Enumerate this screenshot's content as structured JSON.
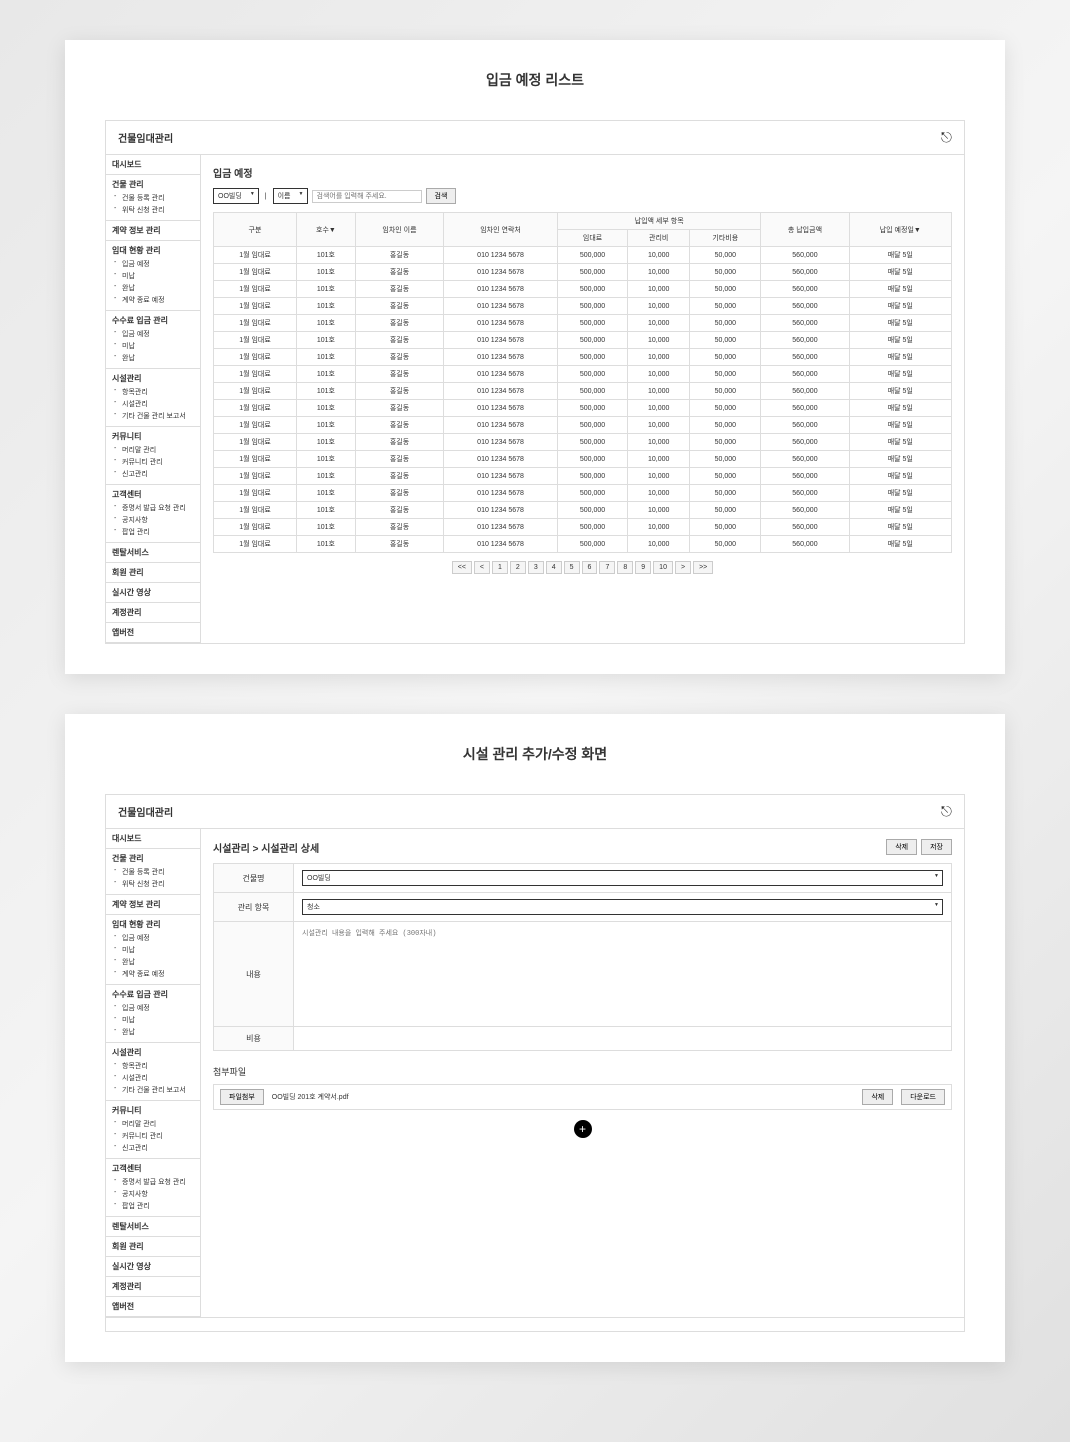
{
  "screen1": {
    "title": "입금 예정 리스트",
    "app_title": "건물임대관리",
    "page_heading": "입금 예정",
    "search": {
      "building_select": "OO빌딩",
      "type_select": "이름",
      "placeholder": "검색어를 입력해 주세요.",
      "button": "검색"
    },
    "table": {
      "headers": {
        "division": "구분",
        "room": "호수▼",
        "tenant_name": "임차인 이름",
        "tenant_contact": "임차인 연락처",
        "payment_detail": "납입액 세부 항목",
        "rent": "임대료",
        "mgmt_fee": "관리비",
        "other_fee": "기타비용",
        "total": "총 납입금액",
        "due_date": "납입 예정일▼"
      },
      "rows": [
        {
          "division": "1월 임대료",
          "room": "101호",
          "name": "홍길동",
          "contact": "010 1234 5678",
          "rent": "500,000",
          "mgmt": "10,000",
          "other": "50,000",
          "total": "560,000",
          "due": "매달 5일"
        },
        {
          "division": "1월 임대료",
          "room": "101호",
          "name": "홍길동",
          "contact": "010 1234 5678",
          "rent": "500,000",
          "mgmt": "10,000",
          "other": "50,000",
          "total": "560,000",
          "due": "매달 5일"
        },
        {
          "division": "1월 임대료",
          "room": "101호",
          "name": "홍길동",
          "contact": "010 1234 5678",
          "rent": "500,000",
          "mgmt": "10,000",
          "other": "50,000",
          "total": "560,000",
          "due": "매달 5일"
        },
        {
          "division": "1월 임대료",
          "room": "101호",
          "name": "홍길동",
          "contact": "010 1234 5678",
          "rent": "500,000",
          "mgmt": "10,000",
          "other": "50,000",
          "total": "560,000",
          "due": "매달 5일"
        },
        {
          "division": "1월 임대료",
          "room": "101호",
          "name": "홍길동",
          "contact": "010 1234 5678",
          "rent": "500,000",
          "mgmt": "10,000",
          "other": "50,000",
          "total": "560,000",
          "due": "매달 5일"
        },
        {
          "division": "1월 임대료",
          "room": "101호",
          "name": "홍길동",
          "contact": "010 1234 5678",
          "rent": "500,000",
          "mgmt": "10,000",
          "other": "50,000",
          "total": "560,000",
          "due": "매달 5일"
        },
        {
          "division": "1월 임대료",
          "room": "101호",
          "name": "홍길동",
          "contact": "010 1234 5678",
          "rent": "500,000",
          "mgmt": "10,000",
          "other": "50,000",
          "total": "560,000",
          "due": "매달 5일"
        },
        {
          "division": "1월 임대료",
          "room": "101호",
          "name": "홍길동",
          "contact": "010 1234 5678",
          "rent": "500,000",
          "mgmt": "10,000",
          "other": "50,000",
          "total": "560,000",
          "due": "매달 5일"
        },
        {
          "division": "1월 임대료",
          "room": "101호",
          "name": "홍길동",
          "contact": "010 1234 5678",
          "rent": "500,000",
          "mgmt": "10,000",
          "other": "50,000",
          "total": "560,000",
          "due": "매달 5일"
        },
        {
          "division": "1월 임대료",
          "room": "101호",
          "name": "홍길동",
          "contact": "010 1234 5678",
          "rent": "500,000",
          "mgmt": "10,000",
          "other": "50,000",
          "total": "560,000",
          "due": "매달 5일"
        },
        {
          "division": "1월 임대료",
          "room": "101호",
          "name": "홍길동",
          "contact": "010 1234 5678",
          "rent": "500,000",
          "mgmt": "10,000",
          "other": "50,000",
          "total": "560,000",
          "due": "매달 5일"
        },
        {
          "division": "1월 임대료",
          "room": "101호",
          "name": "홍길동",
          "contact": "010 1234 5678",
          "rent": "500,000",
          "mgmt": "10,000",
          "other": "50,000",
          "total": "560,000",
          "due": "매달 5일"
        },
        {
          "division": "1월 임대료",
          "room": "101호",
          "name": "홍길동",
          "contact": "010 1234 5678",
          "rent": "500,000",
          "mgmt": "10,000",
          "other": "50,000",
          "total": "560,000",
          "due": "매달 5일"
        },
        {
          "division": "1월 임대료",
          "room": "101호",
          "name": "홍길동",
          "contact": "010 1234 5678",
          "rent": "500,000",
          "mgmt": "10,000",
          "other": "50,000",
          "total": "560,000",
          "due": "매달 5일"
        },
        {
          "division": "1월 임대료",
          "room": "101호",
          "name": "홍길동",
          "contact": "010 1234 5678",
          "rent": "500,000",
          "mgmt": "10,000",
          "other": "50,000",
          "total": "560,000",
          "due": "매달 5일"
        },
        {
          "division": "1월 임대료",
          "room": "101호",
          "name": "홍길동",
          "contact": "010 1234 5678",
          "rent": "500,000",
          "mgmt": "10,000",
          "other": "50,000",
          "total": "560,000",
          "due": "매달 5일"
        },
        {
          "division": "1월 임대료",
          "room": "101호",
          "name": "홍길동",
          "contact": "010 1234 5678",
          "rent": "500,000",
          "mgmt": "10,000",
          "other": "50,000",
          "total": "560,000",
          "due": "매달 5일"
        },
        {
          "division": "1월 임대료",
          "room": "101호",
          "name": "홍길동",
          "contact": "010 1234 5678",
          "rent": "500,000",
          "mgmt": "10,000",
          "other": "50,000",
          "total": "560,000",
          "due": "매달 5일"
        }
      ]
    },
    "pagination": {
      "first": "<<",
      "prev": "<",
      "pages": [
        "1",
        "2",
        "3",
        "4",
        "5",
        "6",
        "7",
        "8",
        "9",
        "10"
      ],
      "next": ">",
      "last": ">>"
    }
  },
  "screen2": {
    "title": "시설 관리 추가/수정 화면",
    "app_title": "건물임대관리",
    "page_heading": "시설관리 > 시설관리 상세",
    "actions": {
      "delete": "삭제",
      "save": "저장"
    },
    "form": {
      "building_label": "건물명",
      "building_value": "OO빌딩",
      "item_label": "관리 항목",
      "item_value": "청소",
      "content_label": "내용",
      "content_placeholder": "시설관리 내용을 입력해 주세요 (300자내)",
      "cost_label": "비용"
    },
    "attach": {
      "title": "첨부파일",
      "attach_btn": "파일첨부",
      "filename": "OO빌딩 201호 계약서.pdf",
      "delete_btn": "삭제",
      "download_btn": "다운로드"
    }
  },
  "sidebar": {
    "groups": [
      {
        "title": "대시보드",
        "subs": []
      },
      {
        "title": "건물 관리",
        "subs": [
          "건물 등록 관리",
          "위탁 신청 관리"
        ]
      },
      {
        "title": "계약 정보 관리",
        "subs": []
      },
      {
        "title": "임대 현황 관리",
        "subs": [
          "입금 예정",
          "미납",
          "완납",
          "계약 종료 예정"
        ]
      },
      {
        "title": "수수료 입금 관리",
        "subs": [
          "입금 예정",
          "미납",
          "완납"
        ]
      },
      {
        "title": "시설관리",
        "subs": [
          "항목관리",
          "시설관리",
          "기타 건물 관리 보고서"
        ]
      },
      {
        "title": "커뮤니티",
        "subs": [
          "머리말 관리",
          "커뮤니티 관리",
          "신고관리"
        ]
      },
      {
        "title": "고객센터",
        "subs": [
          "증명서 발급 요청 관리",
          "공지사항",
          "팝업 관리"
        ]
      },
      {
        "title": "렌탈서비스",
        "subs": []
      },
      {
        "title": "회원 관리",
        "subs": []
      },
      {
        "title": "실시간 영상",
        "subs": []
      },
      {
        "title": "계정관리",
        "subs": []
      },
      {
        "title": "앱버전",
        "subs": []
      }
    ]
  }
}
